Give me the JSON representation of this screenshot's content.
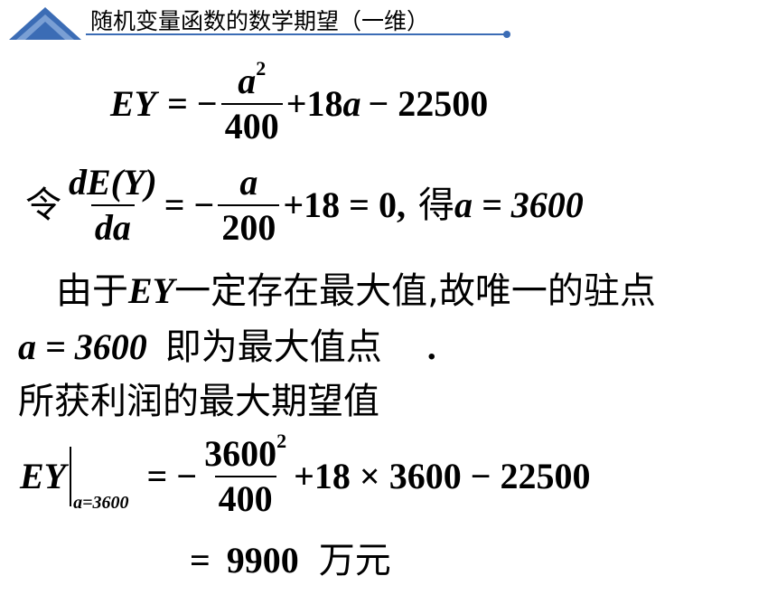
{
  "header": {
    "title": "随机变量函数的数学期望（一维）"
  },
  "eq1": {
    "lhs": "EY",
    "eq_minus": "= −",
    "num_var": "a",
    "num_exp": "2",
    "den": "400",
    "tail_plus": "+18",
    "tail_var": "a",
    "tail_rest": "− 22500"
  },
  "eq2": {
    "ling": "令",
    "dnum": "dE(Y)",
    "dden": "da",
    "eq_minus": "= −",
    "num": "a",
    "den": "200",
    "tail": "+18 = 0,",
    "de": "得",
    "result": "a = 3600"
  },
  "text1": {
    "pre": "由于",
    "ey": "EY",
    "post": "一定存在最大值,故唯一的驻点"
  },
  "text2": {
    "val": "a = 3600",
    "post": "即为最大值点",
    "dot": "."
  },
  "text3": "所获利润的最大期望值",
  "eq3": {
    "lhs": "EY",
    "sub": "a=3600",
    "eq_minus": "= −",
    "num": "3600",
    "num_exp": "2",
    "den": "400",
    "tail": "+18 × 3600 − 22500"
  },
  "eq4": {
    "eq": "=",
    "val": "9900",
    "unit": "万元"
  }
}
